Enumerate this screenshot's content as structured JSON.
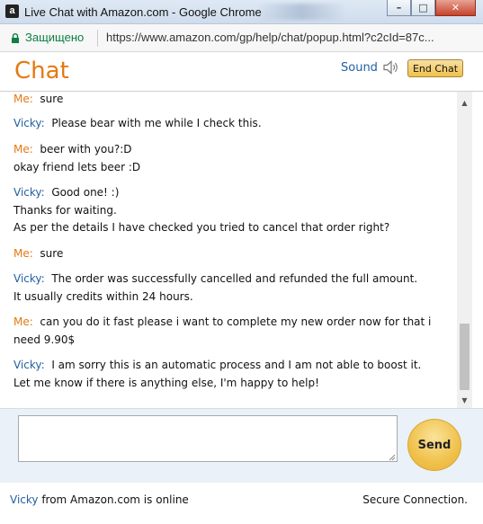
{
  "window": {
    "title": "Live Chat with Amazon.com - Google Chrome",
    "app_icon_letter": "a",
    "minimize": "–",
    "maximize": "□",
    "close": "✕"
  },
  "addressbar": {
    "secure_label": "Защищено",
    "url": "https://www.amazon.com/gp/help/chat/popup.html?c2cId=87c..."
  },
  "header": {
    "title": "Chat",
    "sound_label": "Sound",
    "end_chat_label": "End Chat"
  },
  "messages": [
    {
      "sender": "Me:",
      "role": "me",
      "lines": [
        "sure"
      ]
    },
    {
      "sender": "Vicky:",
      "role": "agent",
      "lines": [
        "Please bear with me while I check this."
      ]
    },
    {
      "sender": "Me:",
      "role": "me",
      "lines": [
        "beer with you?:D",
        "okay friend lets beer :D"
      ]
    },
    {
      "sender": "Vicky:",
      "role": "agent",
      "lines": [
        "Good one! :)",
        "Thanks for waiting.",
        "As per the details I have checked you tried to cancel that order right?"
      ]
    },
    {
      "sender": "Me:",
      "role": "me",
      "lines": [
        "sure"
      ]
    },
    {
      "sender": "Vicky:",
      "role": "agent",
      "lines": [
        "The order was successfully cancelled and refunded the full amount.",
        "It usually credits within 24 hours."
      ]
    },
    {
      "sender": "Me:",
      "role": "me",
      "lines": [
        "can you do it fast please i want to complete my new order now for that i",
        "need 9.90$"
      ]
    },
    {
      "sender": "Vicky:",
      "role": "agent",
      "lines": [
        "I am sorry this is an automatic process and I am not able to boost it.",
        "Let me know if there is anything else, I'm happy to help!"
      ]
    }
  ],
  "input": {
    "value": "",
    "send_label": "Send"
  },
  "footer": {
    "agent_name": "Vicky",
    "status_text": " from Amazon.com is online",
    "secure_connection": "Secure Connection."
  },
  "colors": {
    "brand_orange": "#e47911",
    "agent_blue": "#215fa0",
    "secure_green": "#0b8043",
    "button_gold": "#f0c14b"
  }
}
